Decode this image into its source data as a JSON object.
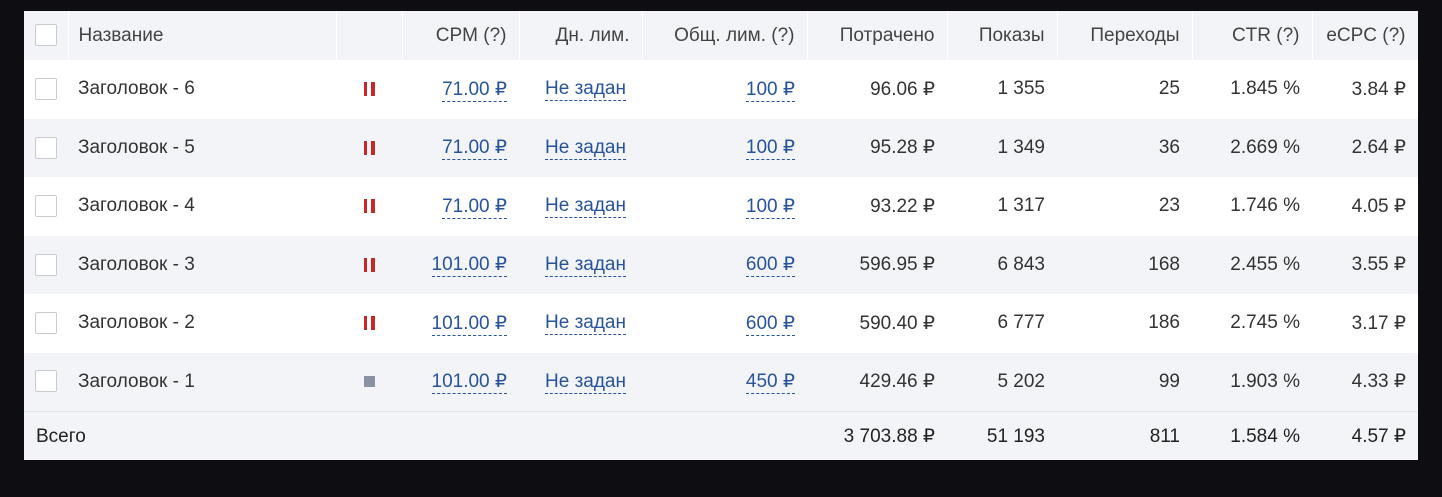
{
  "header": {
    "name": "Название",
    "cpm": "CPM (?)",
    "daily_limit": "Дн. лим.",
    "total_limit": "Общ. лим. (?)",
    "spent": "Потрачено",
    "impressions": "Показы",
    "clicks": "Переходы",
    "ctr": "CTR (?)",
    "ecpc": "eCPC (?)"
  },
  "rows": [
    {
      "name": "Заголовок - 6",
      "status": "pause-icon",
      "cpm": "71.00 ₽",
      "daily": "Не задан",
      "total": "100 ₽",
      "spent": "96.06 ₽",
      "impressions": "1 355",
      "clicks": "25",
      "ctr": "1.845 %",
      "ecpc": "3.84 ₽"
    },
    {
      "name": "Заголовок - 5",
      "status": "pause-icon",
      "cpm": "71.00 ₽",
      "daily": "Не задан",
      "total": "100 ₽",
      "spent": "95.28 ₽",
      "impressions": "1 349",
      "clicks": "36",
      "ctr": "2.669 %",
      "ecpc": "2.64 ₽"
    },
    {
      "name": "Заголовок - 4",
      "status": "pause-icon",
      "cpm": "71.00 ₽",
      "daily": "Не задан",
      "total": "100 ₽",
      "spent": "93.22 ₽",
      "impressions": "1 317",
      "clicks": "23",
      "ctr": "1.746 %",
      "ecpc": "4.05 ₽"
    },
    {
      "name": "Заголовок - 3",
      "status": "pause-icon",
      "cpm": "101.00 ₽",
      "daily": "Не задан",
      "total": "600 ₽",
      "spent": "596.95 ₽",
      "impressions": "6 843",
      "clicks": "168",
      "ctr": "2.455 %",
      "ecpc": "3.55 ₽"
    },
    {
      "name": "Заголовок - 2",
      "status": "pause-icon",
      "cpm": "101.00 ₽",
      "daily": "Не задан",
      "total": "600 ₽",
      "spent": "590.40 ₽",
      "impressions": "6 777",
      "clicks": "186",
      "ctr": "2.745 %",
      "ecpc": "3.17 ₽"
    },
    {
      "name": "Заголовок - 1",
      "status": "stop-icon",
      "cpm": "101.00 ₽",
      "daily": "Не задан",
      "total": "450 ₽",
      "spent": "429.46 ₽",
      "impressions": "5 202",
      "clicks": "99",
      "ctr": "1.903 %",
      "ecpc": "4.33 ₽"
    }
  ],
  "totals": {
    "label": "Всего",
    "spent": "3 703.88 ₽",
    "impressions": "51 193",
    "clicks": "811",
    "ctr": "1.584 %",
    "ecpc": "4.57 ₽"
  },
  "colors": {
    "link": "#27539d",
    "pause": "#c62828",
    "stop": "#8a92a3",
    "header_bg": "#f2f4f7"
  }
}
